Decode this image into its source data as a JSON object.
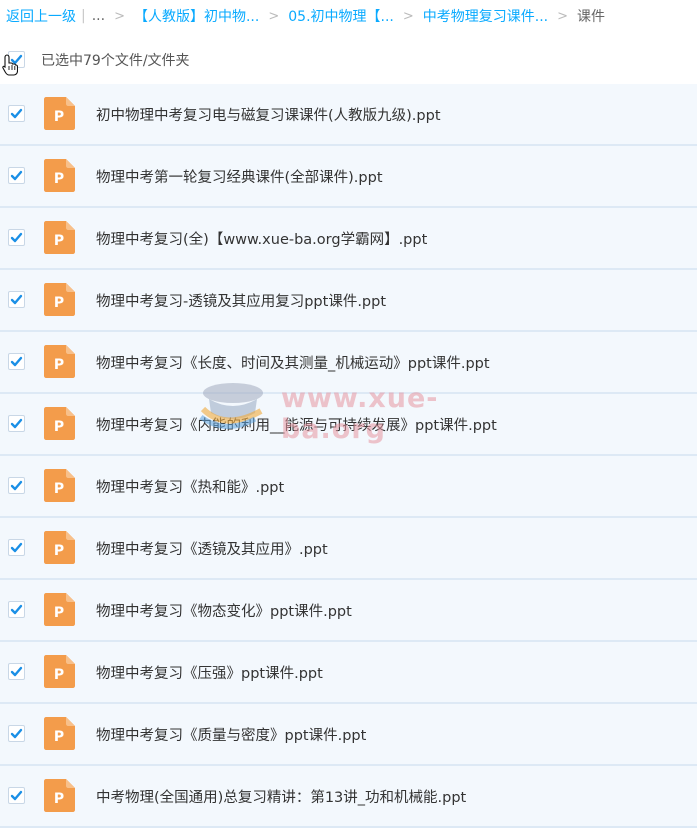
{
  "breadcrumb": {
    "back": "返回上一级",
    "ellipsis": "...",
    "items": [
      "【人教版】初中物...",
      "05.初中物理【...",
      "中考物理复习课件..."
    ],
    "current": "课件"
  },
  "select_all": {
    "label": "已选中79个文件/文件夹",
    "checked": true
  },
  "files": [
    {
      "name": "初中物理中考复习电与磁复习课课件(人教版九级).ppt",
      "checked": true
    },
    {
      "name": "物理中考第一轮复习经典课件(全部课件).ppt",
      "checked": true
    },
    {
      "name": "物理中考复习(全)【www.xue-ba.org学霸网】.ppt",
      "checked": true
    },
    {
      "name": "物理中考复习-透镜及其应用复习ppt课件.ppt",
      "checked": true
    },
    {
      "name": "物理中考复习《长度、时间及其测量_机械运动》ppt课件.ppt",
      "checked": true
    },
    {
      "name": "物理中考复习《内能的利用__能源与可持续发展》ppt课件.ppt",
      "checked": true
    },
    {
      "name": "物理中考复习《热和能》.ppt",
      "checked": true
    },
    {
      "name": "物理中考复习《透镜及其应用》.ppt",
      "checked": true
    },
    {
      "name": "物理中考复习《物态变化》ppt课件.ppt",
      "checked": true
    },
    {
      "name": "物理中考复习《压强》ppt课件.ppt",
      "checked": true
    },
    {
      "name": "物理中考复习《质量与密度》ppt课件.ppt",
      "checked": true
    },
    {
      "name": "中考物理(全国通用)总复习精讲：第13讲_功和机械能.ppt",
      "checked": true
    }
  ],
  "icons": {
    "file": "ppt-file-icon",
    "check": "check-icon",
    "cursor": "hand-cursor-icon"
  },
  "colors": {
    "accent": "#09aaff",
    "check": "#1a8fe6",
    "ppt": "#f39c4b",
    "row_bg": "#f3f8fd"
  },
  "watermark": {
    "text": "www.xue-ba.org"
  }
}
